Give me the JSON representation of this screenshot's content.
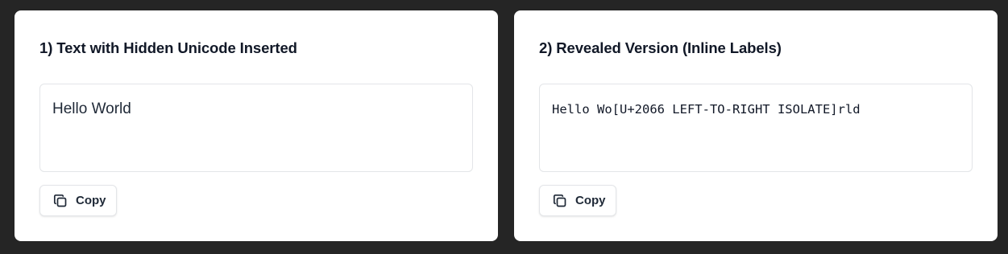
{
  "panels": [
    {
      "title": "1) Text with Hidden Unicode Inserted",
      "text": "Hello World",
      "copy_label": "Copy",
      "copy_icon": "copy-icon"
    },
    {
      "title": "2) Revealed Version (Inline Labels)",
      "text": "Hello Wo[U+2066 LEFT-TO-RIGHT ISOLATE]rld",
      "copy_label": "Copy",
      "copy_icon": "copy-icon"
    }
  ],
  "colors": {
    "background": "#252525",
    "panel": "#ffffff",
    "text": "#111827",
    "border": "#e3e5e8"
  }
}
